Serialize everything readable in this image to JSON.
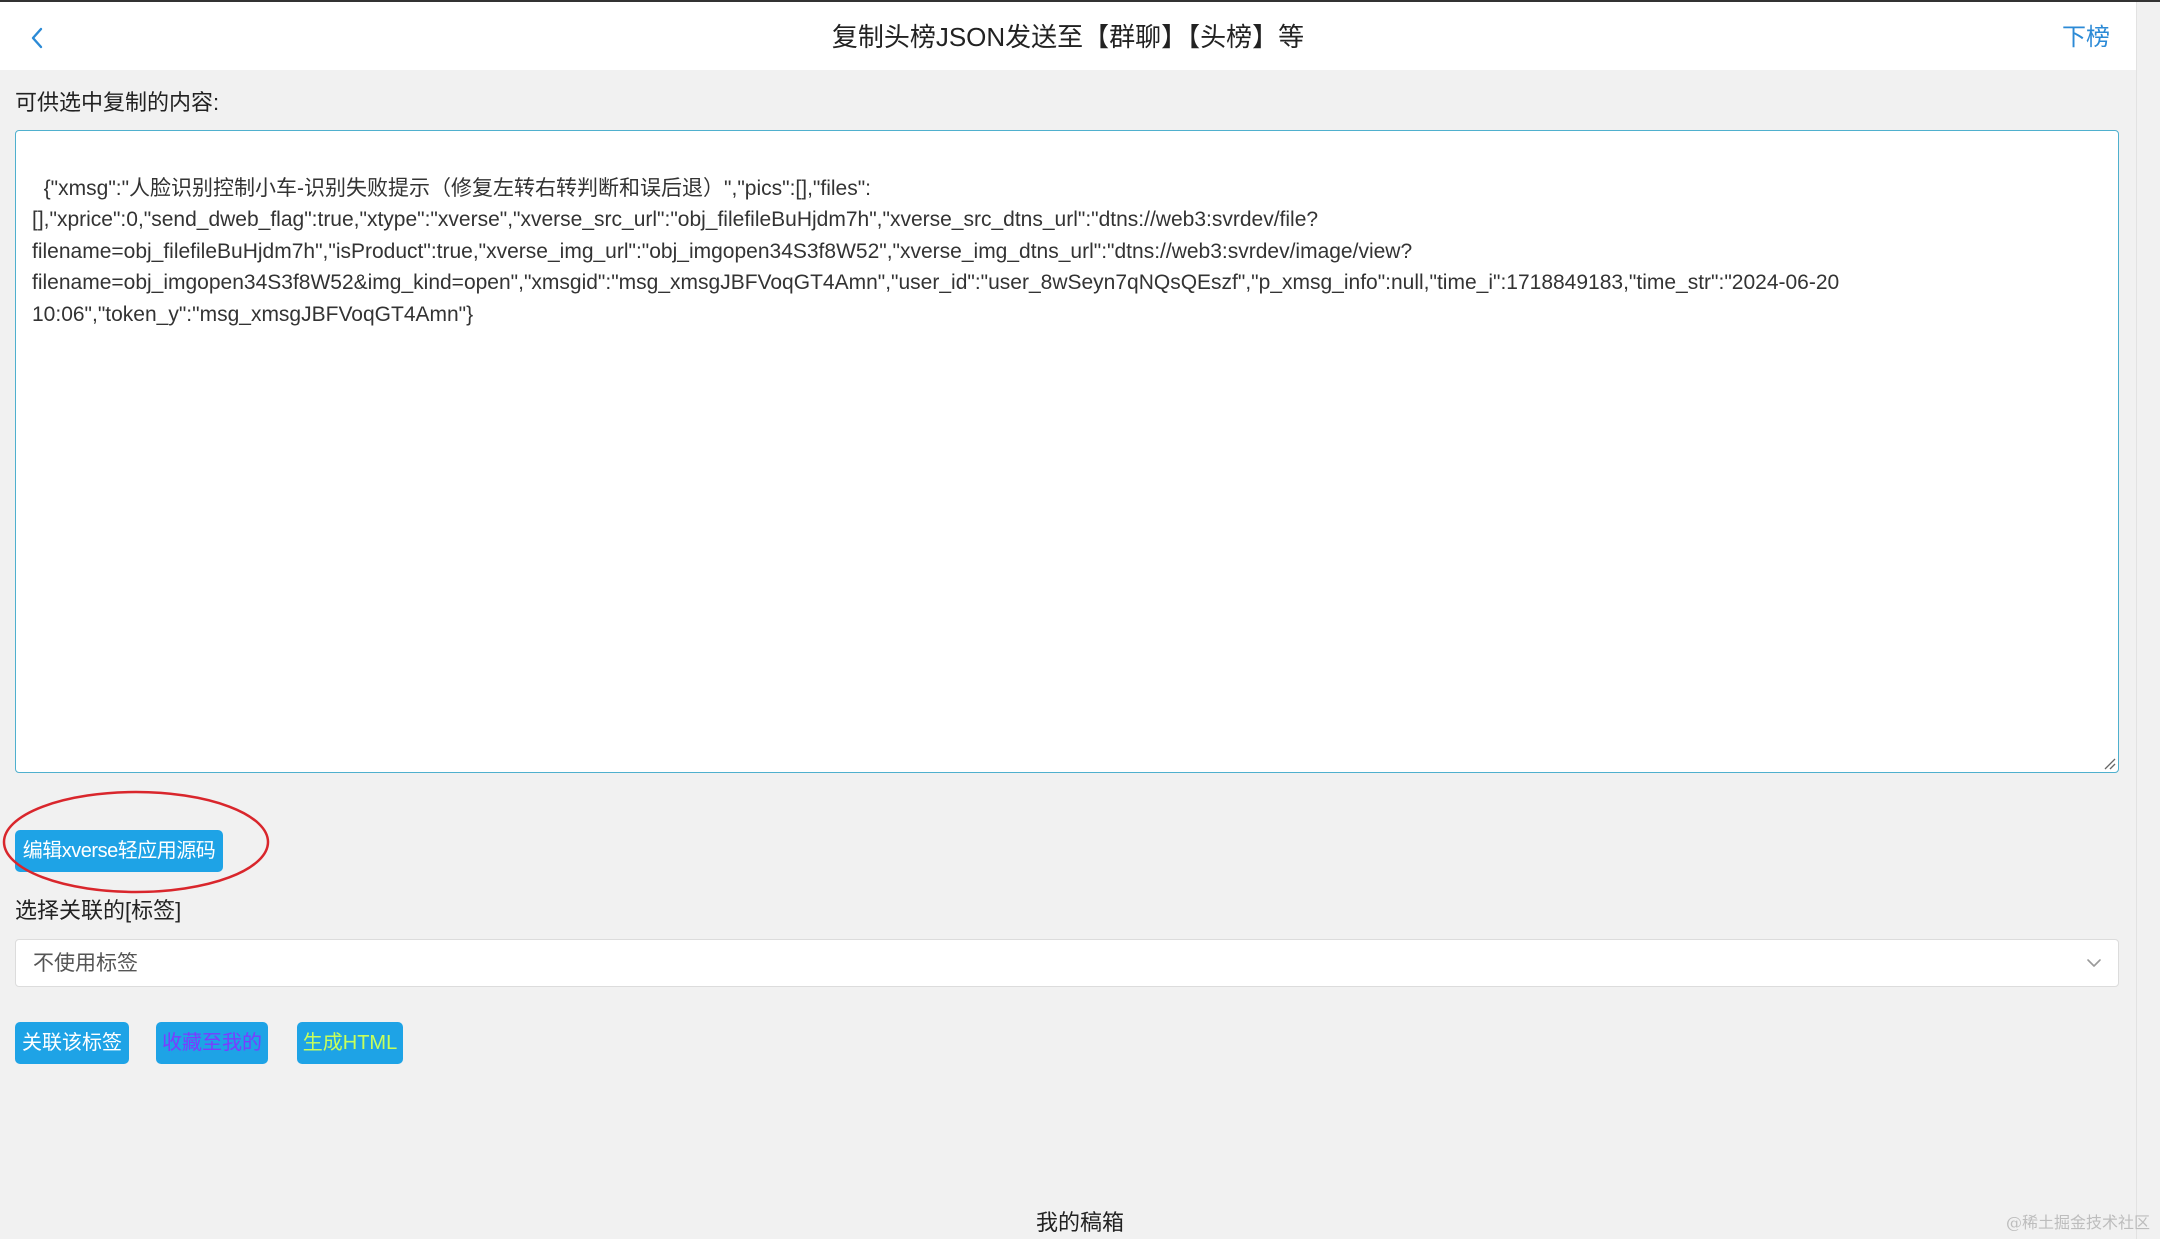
{
  "header": {
    "title": "复制头榜JSON发送至【群聊】【头榜】等",
    "right_link": "下榜"
  },
  "content": {
    "label": "可供选中复制的内容:",
    "json_text": "{\"xmsg\":\"人脸识别控制小车-识别失败提示（修复左转右转判断和误后退）\",\"pics\":[],\"files\":\n[],\"xprice\":0,\"send_dweb_flag\":true,\"xtype\":\"xverse\",\"xverse_src_url\":\"obj_filefileBuHjdm7h\",\"xverse_src_dtns_url\":\"dtns://web3:svrdev/file?\nfilename=obj_filefileBuHjdm7h\",\"isProduct\":true,\"xverse_img_url\":\"obj_imgopen34S3f8W52\",\"xverse_img_dtns_url\":\"dtns://web3:svrdev/image/view?\nfilename=obj_imgopen34S3f8W52&img_kind=open\",\"xmsgid\":\"msg_xmsgJBFVoqGT4Amn\",\"user_id\":\"user_8wSeyn7qNQsQEszf\",\"p_xmsg_info\":null,\"time_i\":1718849183,\"time_str\":\"2024-06-20\n10:06\",\"token_y\":\"msg_xmsgJBFVoqGT4Amn\"}"
  },
  "edit_button": "编辑xverse轻应用源码",
  "tag": {
    "label": "选择关联的[标签]",
    "selected": "不使用标签"
  },
  "actions": {
    "link_tag": "关联该标签",
    "favorite": "收藏至我的",
    "generate_html": "生成HTML"
  },
  "footer": {
    "drafts": "我的稿箱",
    "watermark": "@稀土掘金技术社区"
  },
  "colors": {
    "accent_blue": "#1ea3e6",
    "link_blue": "#2b8ad6",
    "textarea_border": "#4fb0ce",
    "annotation_red": "#d9262c",
    "favorite_text": "#7a3cff",
    "html_text": "#c8ff5a"
  },
  "icons": {
    "back": "chevron-left-icon",
    "dropdown": "chevron-down-icon",
    "resize": "resize-grip-icon"
  }
}
